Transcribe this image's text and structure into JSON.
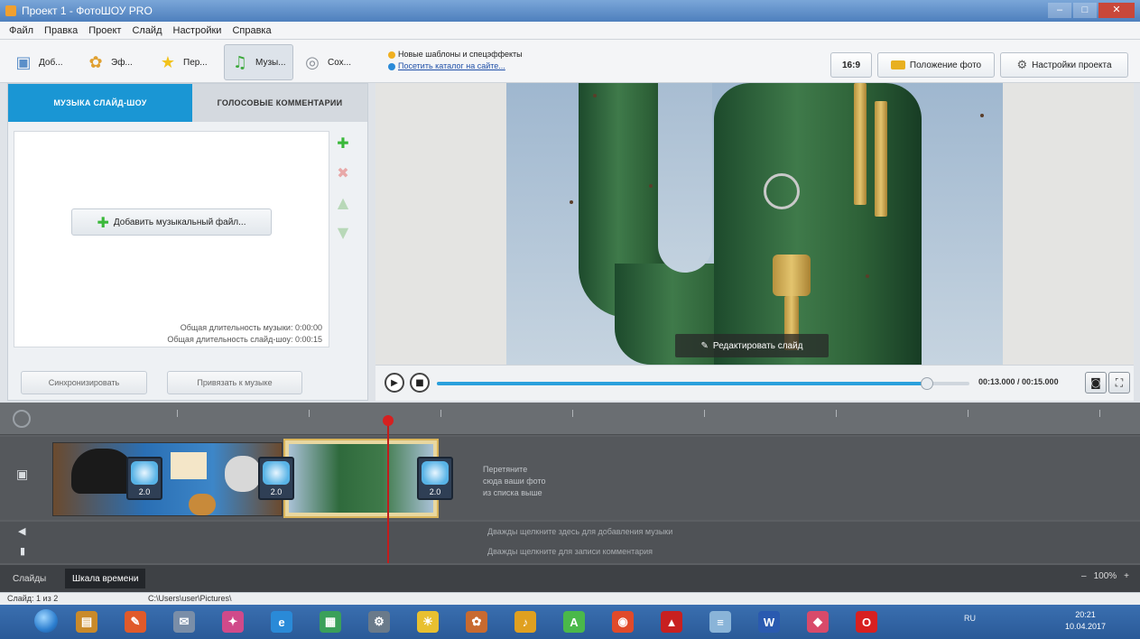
{
  "window": {
    "title": "Проект 1 - ФотоШОУ PRO",
    "controls": [
      "–",
      "□",
      "✕"
    ]
  },
  "menu": [
    "Файл",
    "Правка",
    "Проект",
    "Слайд",
    "Настройки",
    "Справка"
  ],
  "toolbar": {
    "tabs": [
      {
        "label": "Доб...",
        "icon": "image-icon",
        "glyph": "▣",
        "color": "#5b8fc9",
        "active": false
      },
      {
        "label": "Эф...",
        "icon": "puzzle-icon",
        "glyph": "✿",
        "color": "#e0a030",
        "active": false
      },
      {
        "label": "Пер...",
        "icon": "star-icon",
        "glyph": "★",
        "color": "#f2c21a",
        "active": false
      },
      {
        "label": "Музы...",
        "icon": "music-icon",
        "glyph": "♫",
        "color": "#3aa83a",
        "active": true
      },
      {
        "label": "Сох...",
        "icon": "disc-icon",
        "glyph": "◎",
        "color": "#8a9098",
        "active": false
      }
    ],
    "news_line1": "Новые шаблоны и спецэффекты",
    "news_line2": "Посетить каталог на сайте...",
    "aspect_label": "16:9",
    "photo_pos_label": "Положение фото",
    "project_settings_label": "Настройки проекта"
  },
  "left_panel": {
    "tab_music": "МУЗЫКА СЛАЙД-ШОУ",
    "tab_voice": "ГОЛОСОВЫЕ КОММЕНТАРИИ",
    "add_music": "Добавить музыкальный файл...",
    "total_music": "Общая длительность музыки: 0:00:00",
    "total_show": "Общая длительность слайд-шоу: 0:00:15",
    "sync_button": "Синхронизировать",
    "bind_button": "Привязать к музыке"
  },
  "preview": {
    "edit_slide": "Редактировать слайд",
    "timecode": "00:13.000 / 00:15.000",
    "playback_fraction": 0.92
  },
  "timeline": {
    "ruler_labels": [
      "",
      "",
      "",
      "",
      "",
      "",
      "",
      ""
    ],
    "transition_labels": [
      "2.0",
      "2.0",
      "2.0"
    ],
    "drop_line1": "Перетяните",
    "drop_line2": "сюда ваши фото",
    "drop_line3": "из списка выше",
    "music_hint": "Дважды щелкните здесь для добавления музыки",
    "voice_hint": "Дважды щелкните для записи комментария",
    "tab_slides": "Слайды",
    "tab_timeline": "Шкала времени",
    "zoom_minus": "–",
    "zoom": "100%",
    "zoom_plus": "+"
  },
  "status": {
    "slide": "Слайд: 1 из 2",
    "path": "C:\\Users\\user\\Pictures\\"
  },
  "taskbar": {
    "icons": [
      {
        "name": "file-manager-icon",
        "color": "#c98a2a",
        "glyph": "▤"
      },
      {
        "name": "paint-icon",
        "color": "#e05a2a",
        "glyph": "✎"
      },
      {
        "name": "mail-icon",
        "color": "#7a8ea8",
        "glyph": "✉"
      },
      {
        "name": "games-icon",
        "color": "#d04a8a",
        "glyph": "✦"
      },
      {
        "name": "internet-explorer-icon",
        "color": "#2a8ad8",
        "glyph": "e"
      },
      {
        "name": "image-viewer-icon",
        "color": "#3aa05a",
        "glyph": "▦"
      },
      {
        "name": "settings-icon",
        "color": "#6a7a8a",
        "glyph": "⚙"
      },
      {
        "name": "sun-icon",
        "color": "#e8c030",
        "glyph": "☀"
      },
      {
        "name": "flower-icon",
        "color": "#c86a30",
        "glyph": "✿"
      },
      {
        "name": "headphones-icon",
        "color": "#e0a020",
        "glyph": "♪"
      },
      {
        "name": "android-icon",
        "color": "#4ab84a",
        "glyph": "A"
      },
      {
        "name": "chrome-icon",
        "color": "#e04a2a",
        "glyph": "◉"
      },
      {
        "name": "pdf-reader-icon",
        "color": "#c82020",
        "glyph": "▲"
      },
      {
        "name": "notepad-icon",
        "color": "#8ab4d8",
        "glyph": "≡"
      },
      {
        "name": "word-icon",
        "color": "#2a5ab0",
        "glyph": "W"
      },
      {
        "name": "photoshow-icon",
        "color": "#d84a6a",
        "glyph": "◆"
      },
      {
        "name": "opera-icon",
        "color": "#d82020",
        "glyph": "O"
      }
    ],
    "tray": "RU",
    "time": "20:21",
    "date": "10.04.2017"
  }
}
